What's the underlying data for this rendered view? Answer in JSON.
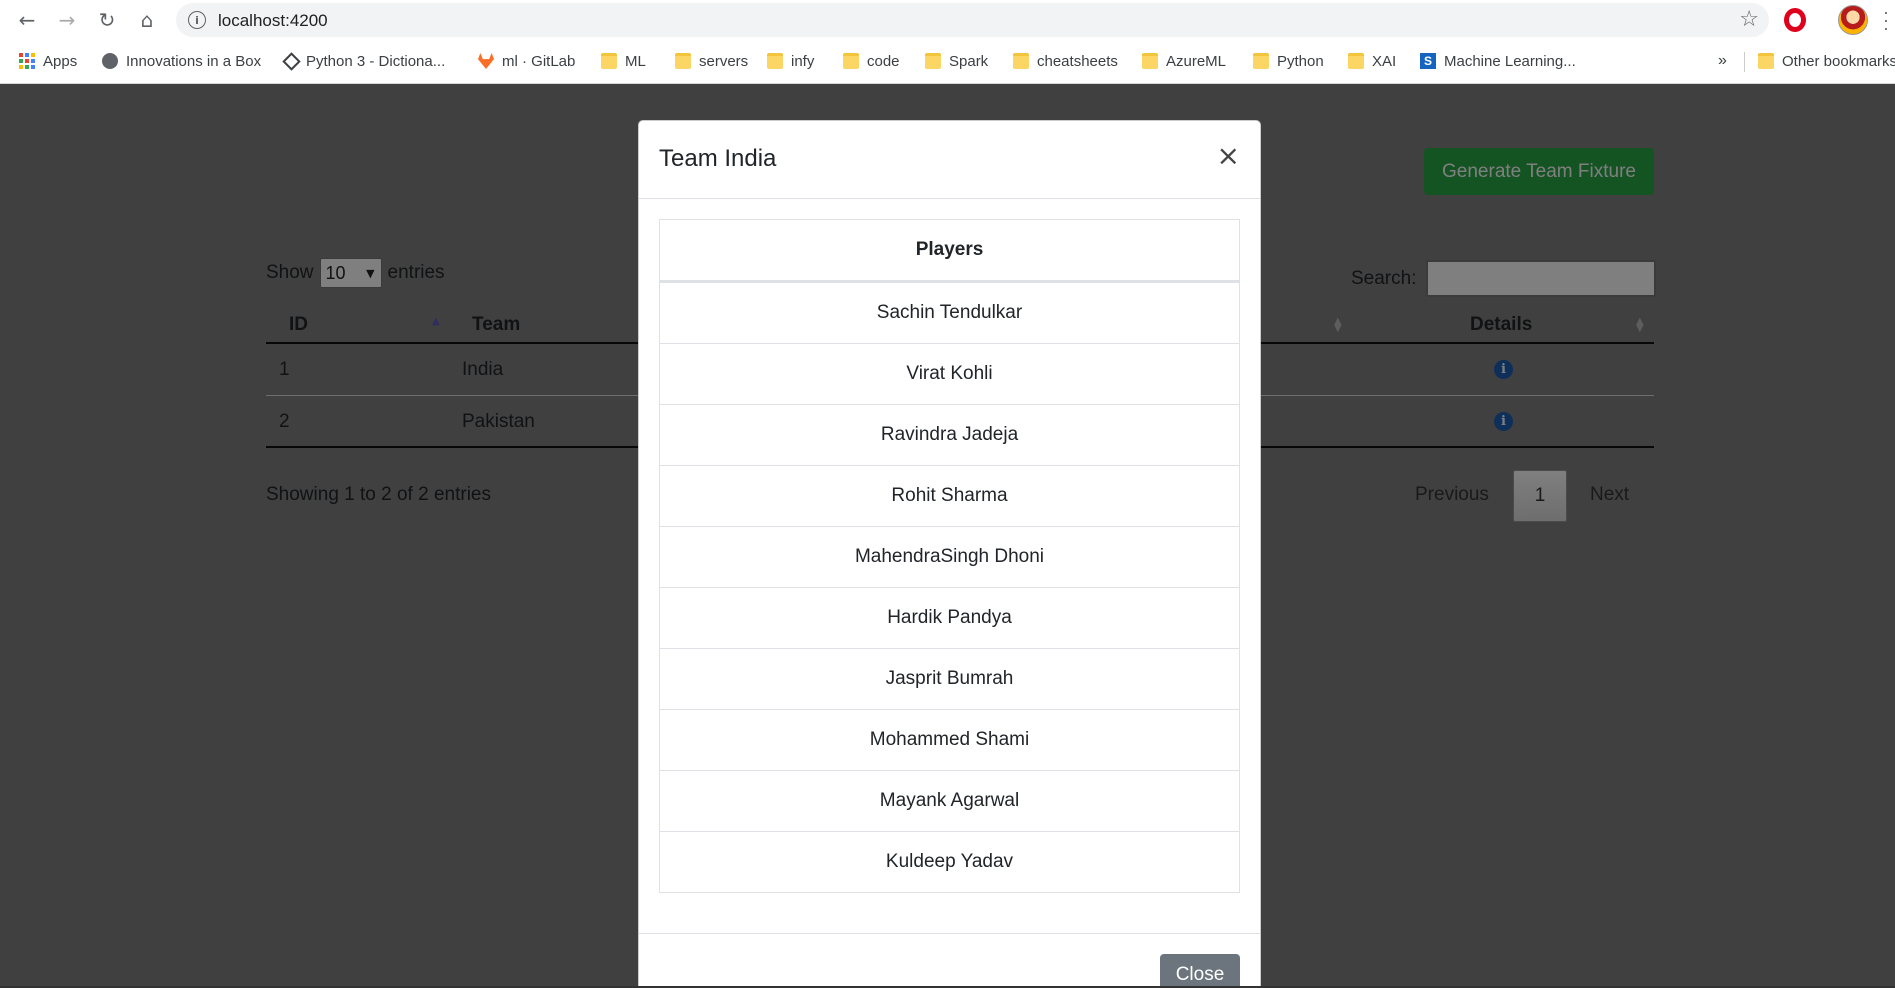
{
  "browser": {
    "url": "localhost:4200",
    "bookmarks": [
      {
        "label": "Apps",
        "icon": "apps-grid-icon"
      },
      {
        "label": "Innovations in a Box",
        "icon": "globe-icon"
      },
      {
        "label": "Python 3 - Dictiona...",
        "icon": "python-icon"
      },
      {
        "label": "ml · GitLab",
        "icon": "gitlab-icon"
      },
      {
        "label": "ML",
        "icon": "folder-icon"
      },
      {
        "label": "servers",
        "icon": "folder-icon"
      },
      {
        "label": "infy",
        "icon": "folder-icon"
      },
      {
        "label": "code",
        "icon": "folder-icon"
      },
      {
        "label": "Spark",
        "icon": "folder-icon"
      },
      {
        "label": "cheatsheets",
        "icon": "folder-icon"
      },
      {
        "label": "AzureML",
        "icon": "folder-icon"
      },
      {
        "label": "Python",
        "icon": "folder-icon"
      },
      {
        "label": "XAI",
        "icon": "folder-icon"
      },
      {
        "label": "Machine Learning...",
        "icon": "s-site-icon"
      }
    ],
    "more_label": "»",
    "other_bookmarks": "Other bookmarks"
  },
  "page": {
    "generate_button": "Generate Team Fixture",
    "show_label": "Show",
    "entries_label": "entries",
    "length_value": "10",
    "search_label": "Search:",
    "columns": {
      "id": "ID",
      "team": "Team",
      "details": "Details"
    },
    "rows": [
      {
        "id": "1",
        "team": "India"
      },
      {
        "id": "2",
        "team": "Pakistan"
      }
    ],
    "info_text": "Showing 1 to 2 of 2 entries",
    "pagination": {
      "previous": "Previous",
      "current": "1",
      "next": "Next"
    }
  },
  "modal": {
    "title": "Team India",
    "close_symbol": "×",
    "players_header": "Players",
    "players": [
      "Sachin Tendulkar",
      "Virat Kohli",
      "Ravindra Jadeja",
      "Rohit Sharma",
      "MahendraSingh Dhoni",
      "Hardik Pandya",
      "Jasprit Bumrah",
      "Mohammed Shami",
      "Mayank Agarwal",
      "Kuldeep Yadav"
    ],
    "close_button": "Close"
  },
  "colors": {
    "success": "#28a745",
    "secondary": "#6c757d",
    "info_icon": "#1a5fb4",
    "backdrop": "rgba(0,0,0,0.5)"
  }
}
